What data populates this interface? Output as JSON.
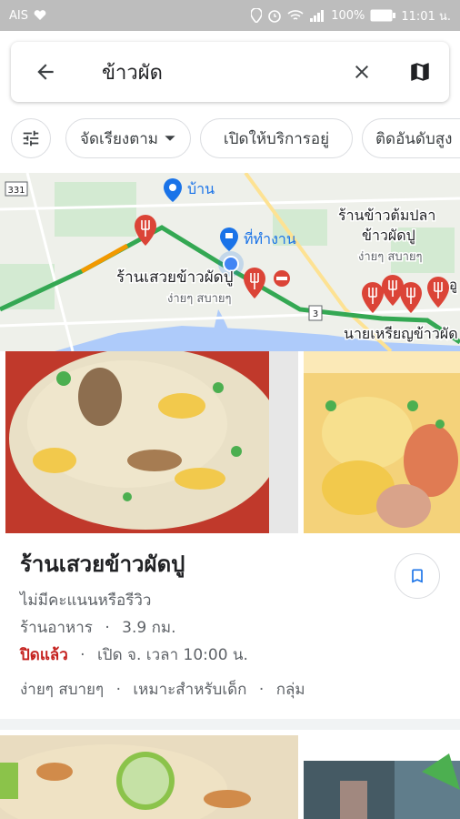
{
  "status_bar": {
    "carrier": "AIS",
    "battery": "100%",
    "time": "11:01 น."
  },
  "search": {
    "query": "ข้าวผัด",
    "back_icon": "arrow-left-icon",
    "clear_icon": "close-icon",
    "map_icon": "map-icon"
  },
  "filters": {
    "filter_icon": "tune-icon",
    "chips": [
      {
        "label": "จัดเรียงตาม"
      },
      {
        "label": "เปิดให้บริการอยู่"
      },
      {
        "label": "ติดอันดับสูง"
      }
    ]
  },
  "map": {
    "labels": {
      "home": "บ้าน",
      "work": "ที่ทำงาน",
      "place1_name": "ร้านเสวยข้าวผัดปู",
      "place1_sub": "ง่ายๆ สบายๆ",
      "place2_name_line1": "ร้านข้าวต้มปลา",
      "place2_name_line2": "ข้าวผัดปู",
      "place2_sub": "ง่ายๆ สบายๆ",
      "place3_name": "นายเหรียญข้าวผัด",
      "road_badge_1": "331",
      "road_badge_2": "3",
      "edge_label": "อู"
    }
  },
  "result": {
    "name": "ร้านเสวยข้าวผัดปู",
    "rating_text": "ไม่มีคะแนนหรือรีวิว",
    "category": "ร้านอาหาร",
    "distance": "3.9 กม.",
    "status": "ปิดแล้ว",
    "hours": "เปิด จ. เวลา 10:00 น.",
    "tags": [
      "ง่ายๆ สบายๆ",
      "เหมาะสำหรับเด็ก",
      "กลุ่ม"
    ],
    "separator": "·",
    "save_icon": "bookmark-icon"
  },
  "colors": {
    "accent": "#1a73e8",
    "closed": "#c5221f",
    "pin": "#db4437",
    "route": "#34a853"
  }
}
